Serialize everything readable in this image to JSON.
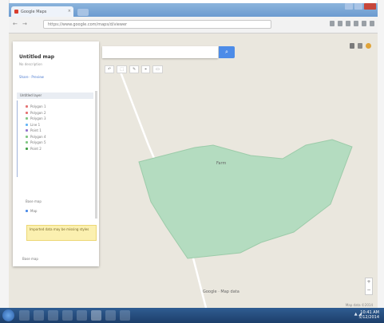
{
  "browser": {
    "tab_title": "Google Maps",
    "tab_close": "×",
    "back": "←",
    "forward": "→",
    "url": "https://www.google.com/maps/d/viewer"
  },
  "search": {
    "placeholder": "",
    "button_icon": "search-icon"
  },
  "map_controls": [
    "↶",
    "⬚",
    "✎",
    "⌖",
    "▭"
  ],
  "panel": {
    "title": "Untitled map",
    "subtitle": "No description",
    "link": "Share · Preview",
    "section_title": "Untitled layer",
    "layers": [
      {
        "label": "Polygon 1",
        "color": "#e57373"
      },
      {
        "label": "Polygon 2",
        "color": "#e57373"
      },
      {
        "label": "Polygon 3",
        "color": "#81c784"
      },
      {
        "label": "Line 1",
        "color": "#64b5f6"
      },
      {
        "label": "Point 1",
        "color": "#9575cd"
      },
      {
        "label": "Polygon 4",
        "color": "#81c784"
      },
      {
        "label": "Polygon 5",
        "color": "#81c784"
      },
      {
        "label": "Point 2",
        "color": "#43a047"
      }
    ],
    "section2_title": "Base map",
    "section2_item": "Map",
    "notice": "Imported data may be missing styles",
    "footer": "Base map"
  },
  "map": {
    "shape_label": "Farm",
    "road_label": "Google · Map data",
    "zoom_in": "+",
    "zoom_out": "−",
    "attribution": "Map data ©2014",
    "polygon_color": "#b4dcc0",
    "background_color": "#eae7de"
  },
  "taskbar": {
    "tray": "▲ ◢",
    "time": "10:41 AM",
    "date": "5/12/2014"
  }
}
